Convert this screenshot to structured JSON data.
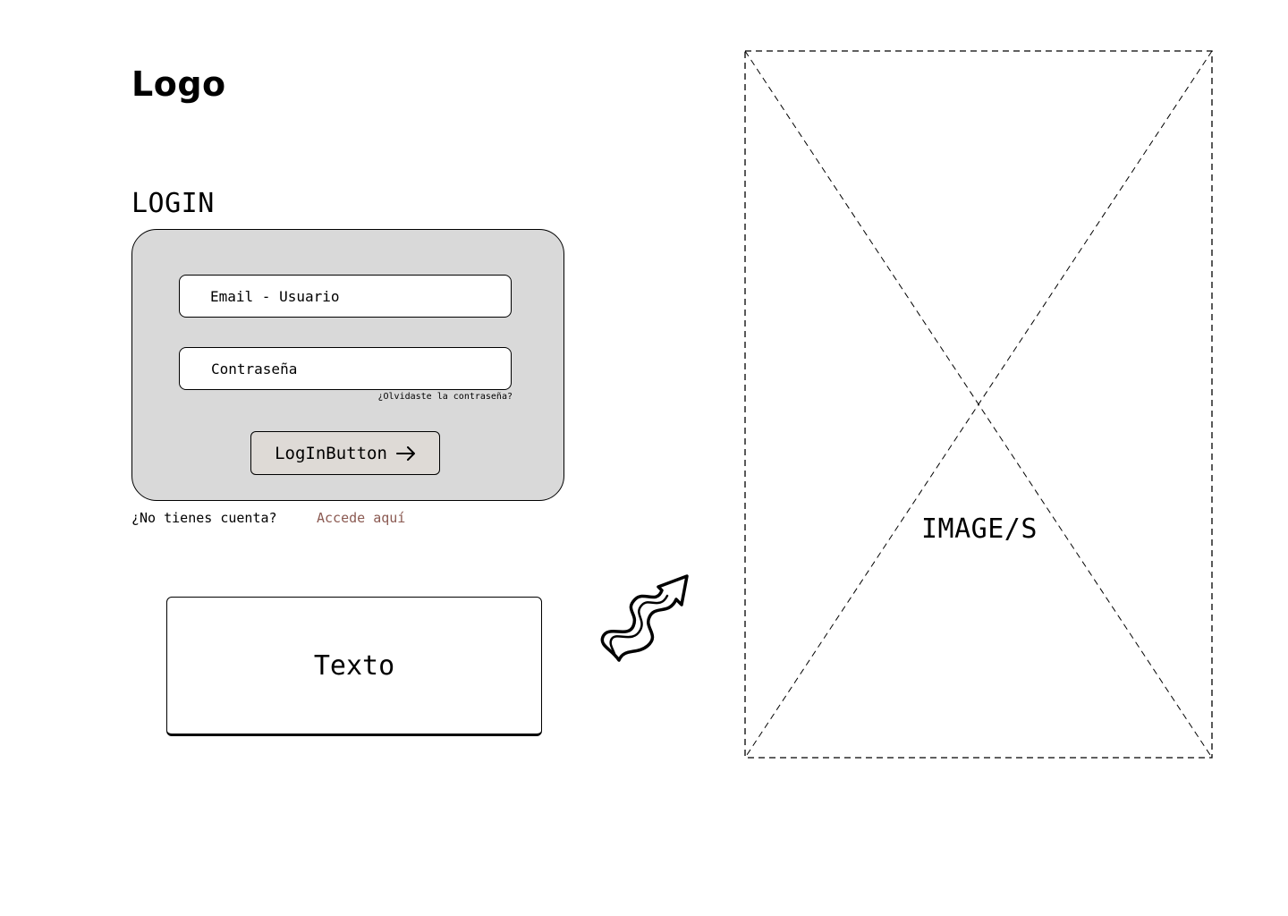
{
  "brand": {
    "logo": "Logo"
  },
  "login": {
    "title": "LOGIN",
    "email_placeholder": "Email - Usuario",
    "password_placeholder": "Contraseña",
    "forgot_label": "¿Olvidaste la contraseña?",
    "button_label": "LogInButton",
    "button_icon": "arrow-right-icon",
    "no_account_label": "¿No tienes cuenta?",
    "signup_link_label": "Accede aquí"
  },
  "text_box": {
    "label": "Texto"
  },
  "image_placeholder": {
    "label": "IMAGE/S"
  },
  "colors": {
    "card_bg": "#d9d9d9",
    "button_bg": "#dedad6",
    "link": "#8b5a52"
  }
}
